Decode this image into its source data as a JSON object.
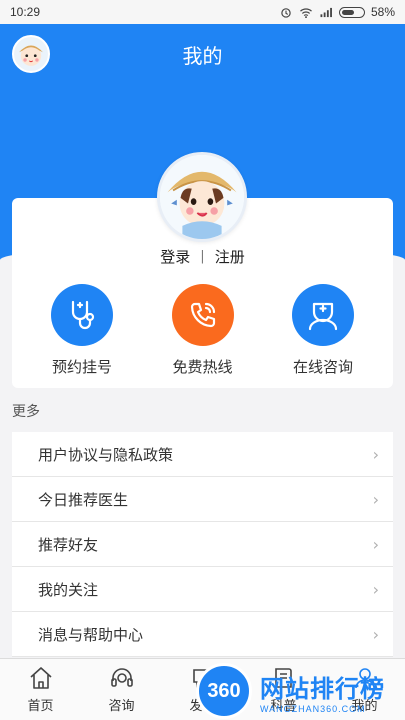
{
  "status_bar": {
    "time": "10:29",
    "battery": "58%"
  },
  "header": {
    "title": "我的"
  },
  "profile": {
    "login": "登录",
    "separator": "|",
    "register": "注册"
  },
  "actions": [
    {
      "label": "预约挂号",
      "icon": "stethoscope-icon",
      "color": "#1f84f4"
    },
    {
      "label": "免费热线",
      "icon": "phone-call-icon",
      "color": "#fa6a1e"
    },
    {
      "label": "在线咨询",
      "icon": "doctor-icon",
      "color": "#1f84f4"
    }
  ],
  "more": {
    "title": "更多",
    "items": [
      {
        "label": "用户协议与隐私政策"
      },
      {
        "label": "今日推荐医生"
      },
      {
        "label": "推荐好友"
      },
      {
        "label": "我的关注"
      },
      {
        "label": "消息与帮助中心"
      }
    ]
  },
  "tabs": [
    {
      "label": "首页",
      "icon": "home-icon"
    },
    {
      "label": "咨询",
      "icon": "headset-icon"
    },
    {
      "label": "发现",
      "icon": "chat-icon"
    },
    {
      "label": "科普",
      "icon": "book-icon"
    },
    {
      "label": "我的",
      "icon": "person-icon"
    }
  ],
  "watermark": {
    "logo": "360",
    "cn": "网站排行榜",
    "en": "WANGZHAN360.COM"
  },
  "colors": {
    "primary": "#1f84f4",
    "accent": "#fa6a1e"
  }
}
